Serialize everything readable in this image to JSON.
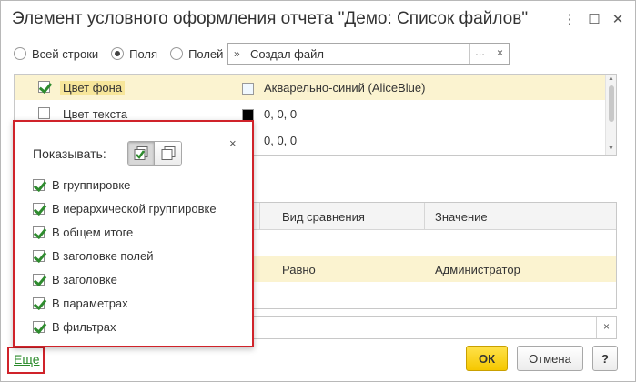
{
  "window": {
    "title": "Элемент условного оформления отчета \"Демо: Список файлов\"",
    "more_icon": "⋮",
    "maximize_icon": "☐",
    "close_icon": "✕"
  },
  "rows_selector": {
    "options": [
      {
        "label": "Всей строки",
        "selected": false
      },
      {
        "label": "Поля",
        "selected": true
      },
      {
        "label": "Полей",
        "selected": false
      }
    ],
    "field_value": "Создал файл",
    "chevrons": "»",
    "more_button": "...",
    "clear_button": "×"
  },
  "appearance": {
    "rows": [
      {
        "checked": true,
        "name": "Цвет фона",
        "swatch": "#f0f8ff",
        "value": "Акварельно-синий (AliceBlue)",
        "selected": true
      },
      {
        "checked": false,
        "name": "Цвет текста",
        "swatch": "#000000",
        "value": "0, 0, 0",
        "selected": false
      },
      {
        "checked": false,
        "name": "",
        "swatch": "#000000",
        "value": "0, 0, 0",
        "selected": false
      }
    ]
  },
  "conditions": {
    "columns": [
      "Вид сравнения",
      "Значение"
    ],
    "row": {
      "comparison": "Равно",
      "value": "Администратор"
    }
  },
  "footer_field": {
    "clear_button": "×"
  },
  "buttons": {
    "more_link": "Еще",
    "ok": "ОК",
    "cancel": "Отмена",
    "help": "?"
  },
  "popup": {
    "close": "×",
    "show_label": "Показывать:",
    "items": [
      {
        "label": "В группировке",
        "checked": true
      },
      {
        "label": "В иерархической группировке",
        "checked": true
      },
      {
        "label": "В общем итоге",
        "checked": true
      },
      {
        "label": "В заголовке полей",
        "checked": true
      },
      {
        "label": "В заголовке",
        "checked": true
      },
      {
        "label": "В параметрах",
        "checked": true
      },
      {
        "label": "В фильтрах",
        "checked": true
      }
    ]
  },
  "colors": {
    "accent_yellow": "#f5c700",
    "selection": "#fbf3d0",
    "highlight_red": "#d0232a",
    "link_green": "#2a8a2a",
    "check_green": "#2e8b2e"
  }
}
